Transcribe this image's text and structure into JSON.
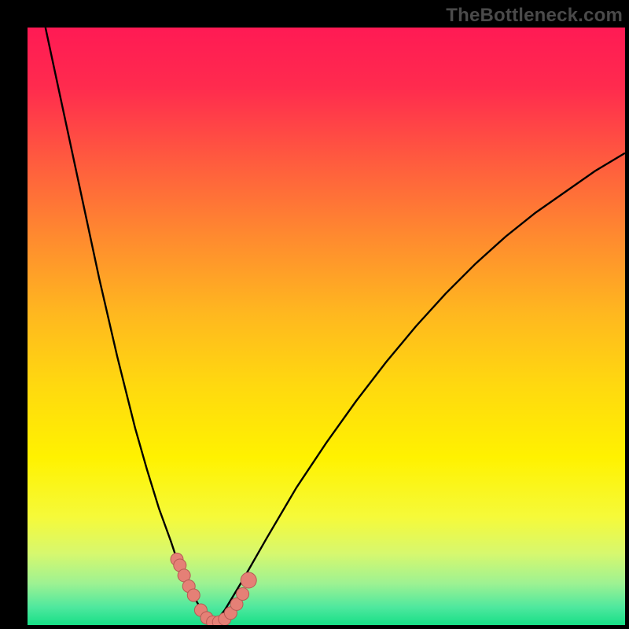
{
  "watermark": "TheBottleneck.com",
  "palette": {
    "gradient_stops": [
      {
        "offset": 0.0,
        "color": "#ff1a54"
      },
      {
        "offset": 0.1,
        "color": "#ff2b4e"
      },
      {
        "offset": 0.22,
        "color": "#ff5a3f"
      },
      {
        "offset": 0.35,
        "color": "#ff8a2f"
      },
      {
        "offset": 0.48,
        "color": "#ffb81f"
      },
      {
        "offset": 0.6,
        "color": "#ffd90f"
      },
      {
        "offset": 0.72,
        "color": "#fff200"
      },
      {
        "offset": 0.82,
        "color": "#f5fa3a"
      },
      {
        "offset": 0.88,
        "color": "#d7f86e"
      },
      {
        "offset": 0.93,
        "color": "#9ef292"
      },
      {
        "offset": 0.97,
        "color": "#4fe89e"
      },
      {
        "offset": 1.0,
        "color": "#17df87"
      }
    ],
    "curve_color": "#000000",
    "marker_fill": "#e58076",
    "marker_stroke": "#b65a54"
  },
  "chart_data": {
    "type": "line",
    "title": "",
    "xlabel": "",
    "ylabel": "",
    "xlim": [
      0,
      100
    ],
    "ylim": [
      0,
      100
    ],
    "optimum_x": 31,
    "series": [
      {
        "name": "left-branch",
        "x": [
          3.0,
          6.0,
          9.0,
          12.0,
          15.0,
          18.0,
          20.0,
          22.0,
          24.0,
          25.0,
          26.0,
          27.0,
          28.0,
          29.5,
          31.0
        ],
        "values": [
          100.0,
          86.0,
          72.0,
          58.0,
          45.0,
          33.0,
          26.0,
          19.5,
          14.0,
          11.0,
          8.5,
          6.5,
          4.5,
          1.8,
          0.0
        ]
      },
      {
        "name": "right-branch",
        "x": [
          31.0,
          33.0,
          36.0,
          40.0,
          45.0,
          50.0,
          55.0,
          60.0,
          65.0,
          70.0,
          75.0,
          80.0,
          85.0,
          90.0,
          95.0,
          100.0
        ],
        "values": [
          0.0,
          2.5,
          7.5,
          14.5,
          23.0,
          30.5,
          37.5,
          44.0,
          50.0,
          55.5,
          60.5,
          65.0,
          69.0,
          72.5,
          76.0,
          79.0
        ]
      }
    ],
    "markers": {
      "name": "highlighted-points",
      "x": [
        25.0,
        25.5,
        26.2,
        27.0,
        27.8,
        29.0,
        30.0,
        31.0,
        32.0,
        33.0,
        34.0,
        35.0,
        36.0,
        37.0
      ],
      "values": [
        11.0,
        10.0,
        8.3,
        6.5,
        5.0,
        2.5,
        1.2,
        0.5,
        0.5,
        1.0,
        2.0,
        3.5,
        5.2,
        7.5
      ],
      "radius": [
        8,
        8,
        8,
        8,
        8,
        8,
        8,
        8,
        8,
        8,
        8,
        8,
        8,
        10
      ]
    }
  }
}
